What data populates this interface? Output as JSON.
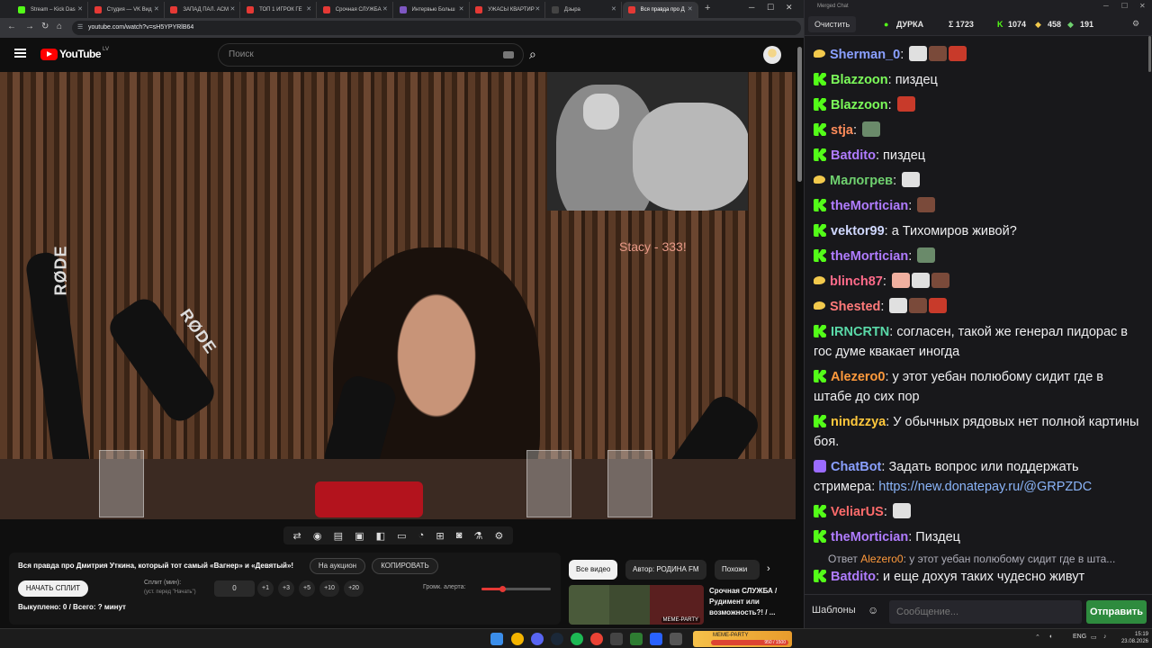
{
  "browser": {
    "tabs": [
      {
        "label": "Stream – Kick Das",
        "color": "#53fc18"
      },
      {
        "label": "Студия — VK Вид",
        "color": "#e53935"
      },
      {
        "label": "ЗАПАД ПАЛ. АСМ",
        "color": "#e53935"
      },
      {
        "label": "ТОП 1 ИГРОК ГЕ",
        "color": "#e53935"
      },
      {
        "label": "Срочная СЛУЖБА",
        "color": "#e53935"
      },
      {
        "label": "Интервью Больш",
        "color": "#7e57c2"
      },
      {
        "label": "УЖАСЫ КВАРТИР",
        "color": "#e53935"
      },
      {
        "label": "Дзыра",
        "color": "#444"
      },
      {
        "label": "Вся правда про Д",
        "color": "#e53935"
      }
    ],
    "new_tab": "+",
    "url": "youtube.com/watch?v=sH5YPYRlB64"
  },
  "youtube": {
    "logo": "YouTube",
    "region": "LV",
    "search_placeholder": "Поиск",
    "overlay_text": "Stacy - 333!",
    "rode_label": "RØDE",
    "video_title": "Вся правда про Дмитрия Уткина, который тот самый «Вагнер» и «Девятый»!",
    "auction_btn": "На аукцион",
    "copy_btn": "КОПИРОВАТЬ",
    "split_btn": "НАЧАТЬ СПЛИТ",
    "split_label": "Сплит (мин):",
    "split_sub": "(уст. перед \"Начать\")",
    "split_value": "0",
    "increments": [
      "+1",
      "+3",
      "+5",
      "+10",
      "+20"
    ],
    "volume_label": "Громк. алерта:",
    "volume_level": 0.3,
    "bought": "Выкуплено: 0 / Всего: ? минут",
    "chips": [
      "Все видео",
      "Автор: РОДИНА FM",
      "Похожи"
    ],
    "rec_title": "Срочная СЛУЖБА / Рудимент или возможность?! / ...",
    "rec_badge": "MEME-PARTY"
  },
  "chat": {
    "window_title": "Merged Chat",
    "clear_btn": "Очистить",
    "channel": "ДУРКА",
    "stat_total": "Σ 1723",
    "stat_kick": "1074",
    "stat_twitch": "458",
    "stat_other": "191",
    "messages": [
      {
        "platform": "t",
        "nick": "Sherman_0",
        "color": "#8aa0ff",
        "text": "",
        "emotes": 3
      },
      {
        "platform": "k",
        "nick": "Blazzoon",
        "color": "#7cfc5a",
        "text": "пиздец",
        "emotes": 0
      },
      {
        "platform": "k",
        "nick": "Blazzoon",
        "color": "#7cfc5a",
        "text": "",
        "emotes": 1
      },
      {
        "platform": "k",
        "nick": "stja",
        "color": "#ff8c5a",
        "text": "",
        "emotes": 1
      },
      {
        "platform": "k",
        "nick": "Batdito",
        "color": "#b07cff",
        "text": "пиздец",
        "emotes": 0
      },
      {
        "platform": "t",
        "nick": "Малогрев",
        "color": "#6fd16f",
        "text": "",
        "emotes": 1
      },
      {
        "platform": "k",
        "nick": "theMortician",
        "color": "#b07cff",
        "text": "",
        "emotes": 1
      },
      {
        "platform": "k",
        "nick": "vektor99",
        "color": "#d0d8ff",
        "text": "а Тихомиров живой?",
        "emotes": 0
      },
      {
        "platform": "k",
        "nick": "theMortician",
        "color": "#b07cff",
        "text": "",
        "emotes": 1
      },
      {
        "platform": "t",
        "nick": "blinch87",
        "color": "#ff6b8a",
        "text": "",
        "emotes": 3
      },
      {
        "platform": "t",
        "nick": "Shested",
        "color": "#ff7a7a",
        "text": "",
        "emotes": 3
      },
      {
        "platform": "k",
        "nick": "IRNCRTN",
        "color": "#5ad9a8",
        "text": "согласен, такой же генерал пидорас в гос думе квакает иногда",
        "emotes": 0
      },
      {
        "platform": "k",
        "nick": "Alezero0",
        "color": "#ff9a3c",
        "text": "у этот уебан полюбому сидит где в штабе до сих пор",
        "emotes": 0
      },
      {
        "platform": "k",
        "nick": "nindzzya",
        "color": "#ffc83c",
        "text": "У обычных рядовых нет полной картины боя.",
        "emotes": 0
      },
      {
        "platform": "r",
        "nick": "ChatBot",
        "color": "#8aa0ff",
        "text": "Задать вопрос или поддержать стримера: ",
        "link": "https://new.donatepay.ru/@GRPZDC",
        "emotes": 0
      },
      {
        "platform": "k",
        "nick": "VeliarUS",
        "color": "#ff6b6b",
        "text": "",
        "emotes": 1
      },
      {
        "platform": "k",
        "nick": "theMortician",
        "color": "#b07cff",
        "text": "Пиздец",
        "emotes": 0
      },
      {
        "reply": "Ответ ",
        "reply_nick": "Alezero0",
        "reply_text": ": у этот уебан полюбому сидит где в шта..."
      },
      {
        "platform": "k",
        "nick": "Batdito",
        "color": "#b07cff",
        "text": "и еще дохуя таких чудесно живут",
        "emotes": 0
      }
    ],
    "templates_btn": "Шаблоны",
    "input_placeholder": "Сообщение...",
    "send_btn": "Отправить"
  },
  "taskbar": {
    "lang": "ENG",
    "time": "15:19",
    "date": "23.08.2026",
    "widget_label": "MEME-PARTY",
    "widget_bar": "950 / 1500"
  }
}
